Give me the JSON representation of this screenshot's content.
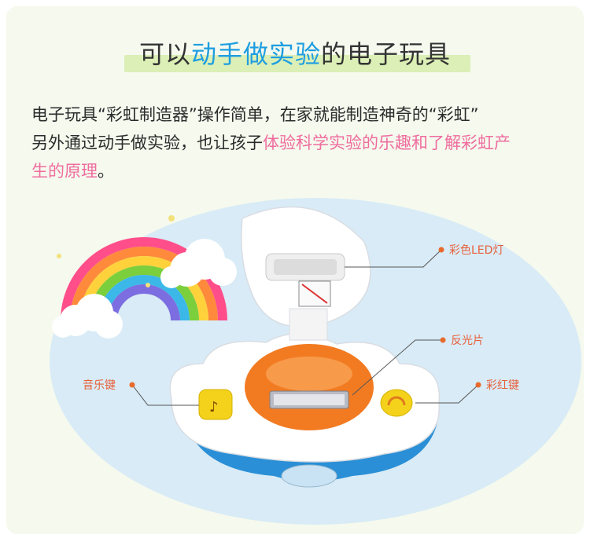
{
  "heading": {
    "part1": "可以",
    "highlight": "动手做实验",
    "part2": "的电子玩具"
  },
  "description": {
    "line1": "电子玩具“彩虹制造器”操作简单，在家就能制造神奇的“彩虹”",
    "line2_plain": "另外通过动手做实验，也让孩子",
    "line2_pink": "体验科学实验的乐趣和了解彩虹产",
    "line3_pink": "生的原理",
    "line3_end": "。"
  },
  "callouts": {
    "led": "彩色LED灯",
    "reflector": "反光片",
    "music": "音乐键",
    "rainbow_key": "彩红键"
  },
  "colors": {
    "title_highlight": "#1e9ee0",
    "pink_text": "#ef6d9e",
    "callout_text": "#e8603c",
    "title_band": "#dbefb6",
    "background": "#f5f9ee"
  }
}
